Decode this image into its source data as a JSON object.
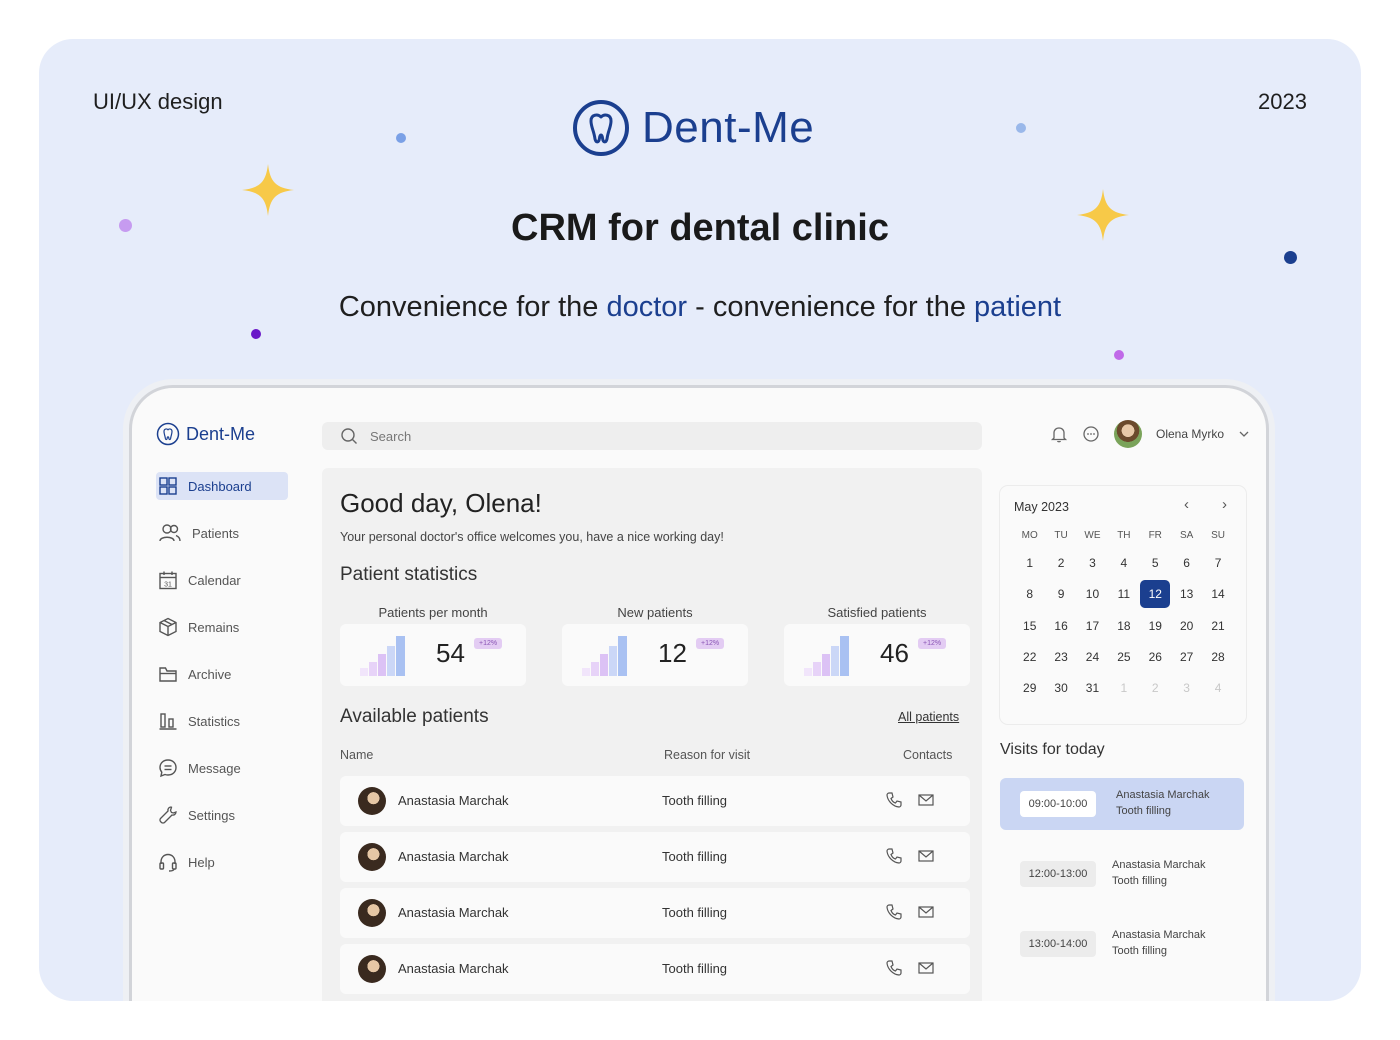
{
  "poster": {
    "corner_left": "UI/UX design",
    "corner_right": "2023",
    "brand": "Dent-Me",
    "headline": "CRM for dental clinic",
    "tagline_1": "Convenience for the ",
    "tagline_accent_1": "doctor",
    "tagline_2": " - convenience for the ",
    "tagline_accent_2": "patient"
  },
  "colors": {
    "brand": "#1b3f8f",
    "background": "#e6ecfa",
    "star": "#f7c948",
    "badge": "#e3ccf3"
  },
  "app": {
    "logo": "Dent-Me",
    "search_placeholder": "Search",
    "icons": [
      "bell-icon",
      "chat-icon",
      "chevron-down-icon"
    ],
    "user_name": "Olena Myrko"
  },
  "sidebar": {
    "items": [
      {
        "label": "Dashboard",
        "icon": "grid-icon",
        "active": true
      },
      {
        "label": "Patients",
        "icon": "users-icon"
      },
      {
        "label": "Calendar",
        "icon": "calendar-icon"
      },
      {
        "label": "Remains",
        "icon": "box-icon"
      },
      {
        "label": "Archive",
        "icon": "folder-icon"
      },
      {
        "label": "Statistics",
        "icon": "bar-chart-icon"
      },
      {
        "label": "Message",
        "icon": "message-icon"
      },
      {
        "label": "Settings",
        "icon": "wrench-icon"
      },
      {
        "label": "Help",
        "icon": "headset-icon"
      }
    ]
  },
  "main": {
    "greeting": "Good day, Olena!",
    "subtitle": "Your personal doctor's office welcomes you, have a nice working day!",
    "stats_title": "Patient statistics",
    "stats": [
      {
        "label": "Patients per month",
        "value": "54",
        "badge": "+12%"
      },
      {
        "label": "New patients",
        "value": "12",
        "badge": "+12%"
      },
      {
        "label": "Satisfied patients",
        "value": "46",
        "badge": "+12%"
      }
    ],
    "available_title": "Available patients",
    "all_link": "All patients",
    "columns": {
      "name": "Name",
      "reason": "Reason for visit",
      "contacts": "Contacts"
    },
    "patients": [
      {
        "name": "Anastasia Marchak",
        "reason": "Tooth filling"
      },
      {
        "name": "Anastasia Marchak",
        "reason": "Tooth filling"
      },
      {
        "name": "Anastasia Marchak",
        "reason": "Tooth filling"
      },
      {
        "name": "Anastasia Marchak",
        "reason": "Tooth filling"
      }
    ]
  },
  "calendar": {
    "month": "May 2023",
    "weekdays": [
      "MO",
      "TU",
      "WE",
      "TH",
      "FR",
      "SA",
      "SU"
    ],
    "days": [
      "1",
      "2",
      "3",
      "4",
      "5",
      "6",
      "7",
      "8",
      "9",
      "10",
      "11",
      "12",
      "13",
      "14",
      "15",
      "16",
      "17",
      "18",
      "19",
      "20",
      "21",
      "22",
      "23",
      "24",
      "25",
      "26",
      "27",
      "28",
      "29",
      "30",
      "31"
    ],
    "next_month_days": [
      "1",
      "2",
      "3",
      "4"
    ],
    "selected": "12"
  },
  "visits": {
    "title": "Visits for today",
    "items": [
      {
        "time": "09:00-10:00",
        "name": "Anastasia Marchak",
        "reason": "Tooth filling",
        "highlighted": true
      },
      {
        "time": "12:00-13:00",
        "name": "Anastasia Marchak",
        "reason": "Tooth filling"
      },
      {
        "time": "13:00-14:00",
        "name": "Anastasia Marchak",
        "reason": "Tooth filling"
      }
    ]
  }
}
